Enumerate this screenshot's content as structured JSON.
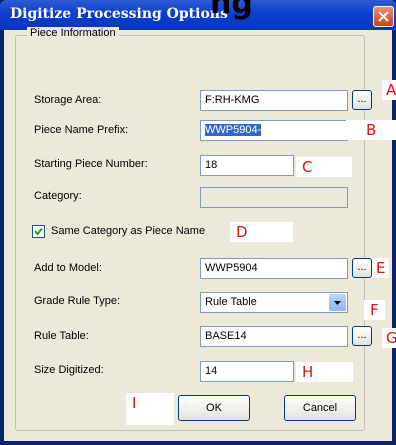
{
  "page_heading": "ng",
  "window": {
    "title": "Digitize Processing Options"
  },
  "group": {
    "legend": "Piece Information"
  },
  "fields": {
    "storage_area": {
      "label": "Storage Area:",
      "value": "F:RH-KMG",
      "button": "..."
    },
    "piece_name_prefix": {
      "label": "Piece Name Prefix:",
      "value": "WWP5904-"
    },
    "starting_piece_number": {
      "label": "Starting Piece Number:",
      "value": "18"
    },
    "category": {
      "label": "Category:",
      "value": ""
    },
    "same_category": {
      "label": "Same Category as Piece Name",
      "checked": true
    },
    "add_to_model": {
      "label": "Add to Model:",
      "value": "WWP5904",
      "button": "..."
    },
    "grade_rule_type": {
      "label": "Grade Rule Type:",
      "value": "Rule Table"
    },
    "rule_table": {
      "label": "Rule Table:",
      "value": "BASE14",
      "button": "..."
    },
    "size_digitized": {
      "label": "Size Digitized:",
      "value": "14"
    }
  },
  "buttons": {
    "ok": "OK",
    "cancel": "Cancel"
  },
  "annotations": {
    "A": "A",
    "B": "B",
    "C": "C",
    "D": "D",
    "E": "E",
    "F": "F",
    "G": "G",
    "H": "H",
    "I": "I"
  },
  "colors": {
    "titlebar": "#0a3fcf",
    "dialog_face": "#ece9d8",
    "selection": "#316ac5",
    "annotation_red": "#e0140c"
  },
  "icons": {
    "close": "close-x-icon",
    "checkbox_check": "checkmark-icon",
    "combo_arrow": "chevron-down-icon"
  }
}
